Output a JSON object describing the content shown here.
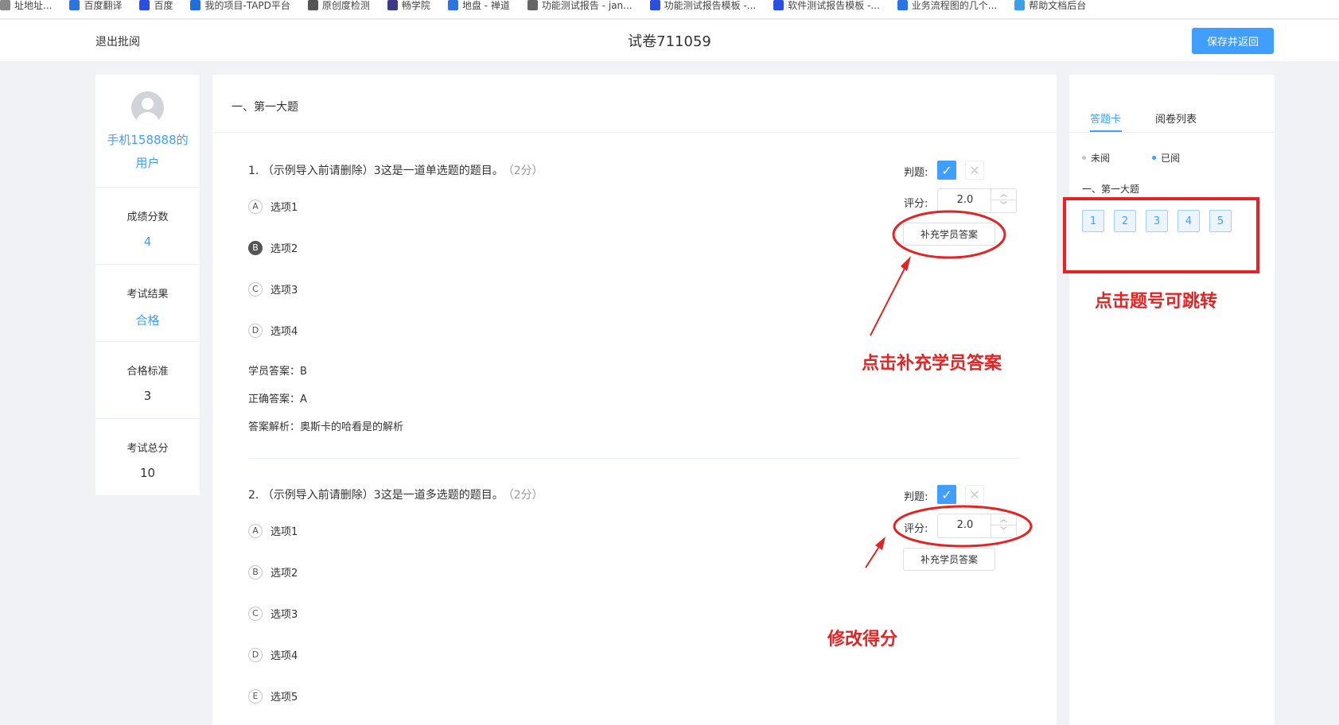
{
  "bookmarks": [
    {
      "label": "址地址...",
      "color": "#888888"
    },
    {
      "label": "百度翻译",
      "color": "#2b74e2"
    },
    {
      "label": "百度",
      "color": "#2b4fe2"
    },
    {
      "label": "我的项目-TAPD平台",
      "color": "#1e6fd9"
    },
    {
      "label": "原创度检测",
      "color": "#555555"
    },
    {
      "label": "畅学院",
      "color": "#3a3a8c"
    },
    {
      "label": "地盘 - 禅道",
      "color": "#2b74e2"
    },
    {
      "label": "功能测试报告 - jan...",
      "color": "#666666"
    },
    {
      "label": "功能测试报告模板 -...",
      "color": "#2b4fe2"
    },
    {
      "label": "软件测试报告模板 -...",
      "color": "#2b4fe2"
    },
    {
      "label": "业务流程图的几个...",
      "color": "#2b74e2"
    },
    {
      "label": "帮助文档后台",
      "color": "#3aa0e8"
    }
  ],
  "header": {
    "exit_label": "退出批阅",
    "title": "试卷711059",
    "save_label": "保存并返回"
  },
  "left": {
    "username": "手机158888的用户",
    "stats": [
      {
        "label": "成绩分数",
        "value": "4"
      },
      {
        "label": "考试结果",
        "value": "合格"
      },
      {
        "label": "合格标准",
        "value": "3"
      },
      {
        "label": "考试总分",
        "value": "10"
      }
    ]
  },
  "main": {
    "section_title": "一、第一大题",
    "judge_label": "判题:",
    "score_label": "评分:",
    "supplement_label": "补充学员答案",
    "questions": [
      {
        "title": "1. （示例导入前请删除）3这是一道单选题的题目。",
        "score": "（2分）",
        "score_value": "2.0",
        "options": [
          {
            "letter": "A",
            "text": "选项1"
          },
          {
            "letter": "B",
            "text": "选项2"
          },
          {
            "letter": "C",
            "text": "选项3"
          },
          {
            "letter": "D",
            "text": "选项4"
          }
        ],
        "student_answer": "学员答案：B",
        "correct_answer": "正确答案：A",
        "analysis": "答案解析：奥斯卡的哈看是的解析"
      },
      {
        "title": "2. （示例导入前请删除）3这是一道多选题的题目。",
        "score": "（2分）",
        "score_value": "2.0",
        "options": [
          {
            "letter": "A",
            "text": "选项1"
          },
          {
            "letter": "B",
            "text": "选项2"
          },
          {
            "letter": "C",
            "text": "选项3"
          },
          {
            "letter": "D",
            "text": "选项4"
          },
          {
            "letter": "E",
            "text": "选项5"
          }
        ]
      }
    ]
  },
  "right": {
    "tabs": [
      "答题卡",
      "阅卷列表"
    ],
    "legend_unread": "未阅",
    "legend_read": "已阅",
    "section_title": "一、第一大题",
    "numbers": [
      "1",
      "2",
      "3",
      "4",
      "5"
    ]
  },
  "annotations": {
    "supplement": "点击补充学员答案",
    "modify": "修改得分",
    "jump": "点击题号可跳转"
  },
  "colors": {
    "accent": "#409eff",
    "annotation": "#e32424"
  }
}
